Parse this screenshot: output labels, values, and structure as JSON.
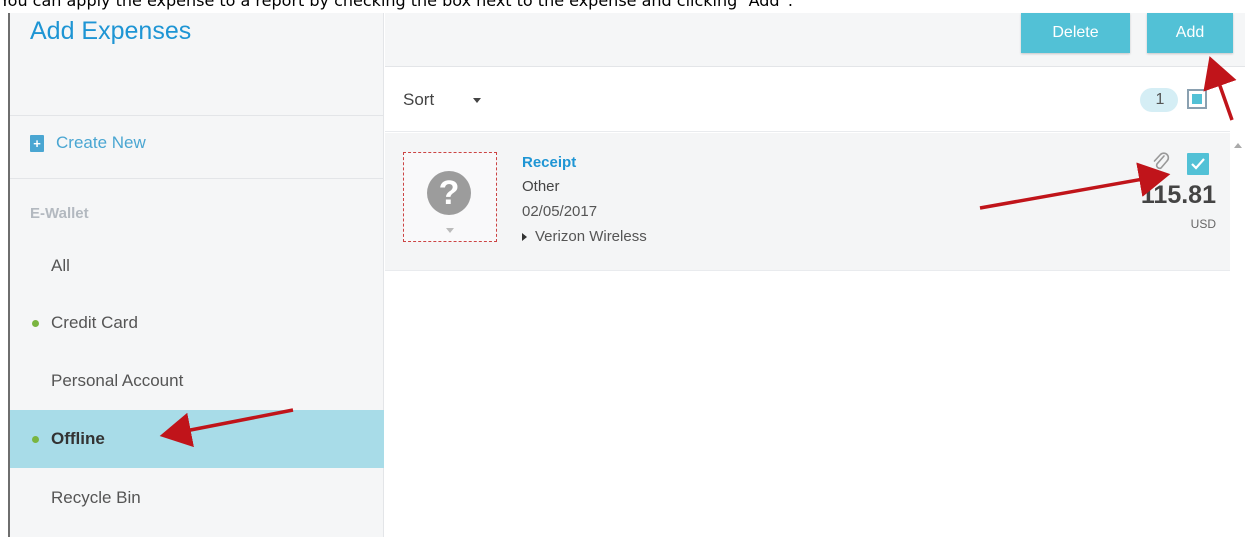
{
  "caption": "You can apply the expense to a report by checking the box next to the expense and clicking “Add”.",
  "sidebar": {
    "title": "Add Expenses",
    "create_new": "Create New",
    "section_label": "E-Wallet",
    "items": [
      {
        "label": "All",
        "dot": false,
        "active": false
      },
      {
        "label": "Credit Card",
        "dot": true,
        "active": false
      },
      {
        "label": "Personal Account",
        "dot": false,
        "active": false
      },
      {
        "label": "Offline",
        "dot": true,
        "active": true
      },
      {
        "label": "Recycle Bin",
        "dot": false,
        "active": false
      }
    ]
  },
  "toolbar": {
    "delete_label": "Delete",
    "add_label": "Add"
  },
  "list": {
    "sort_label": "Sort",
    "selected_count": "1",
    "select_all_state": "partial"
  },
  "expense": {
    "title": "Receipt",
    "type": "Other",
    "date": "02/05/2017",
    "vendor": "Verizon Wireless",
    "amount": "115.81",
    "currency": "USD",
    "checked": true,
    "receipt_icon": "question-mark-icon",
    "attachment_icon": "paperclip-icon"
  },
  "colors": {
    "accent": "#1e95d4",
    "button": "#52c1d6",
    "active_nav": "#a8dce8",
    "dot": "#7ab540",
    "annotation_arrow": "#c0141a"
  }
}
